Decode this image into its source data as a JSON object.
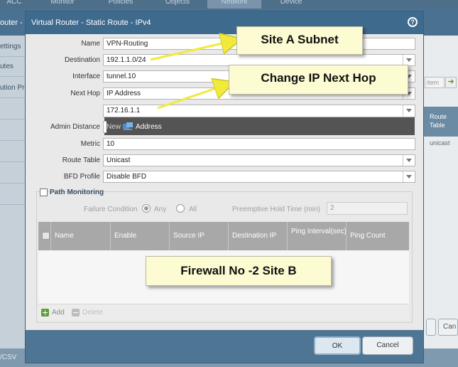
{
  "background": {
    "tabs": [
      "ACC",
      "Monitor",
      "Policies",
      "Objects",
      "Network",
      "Device"
    ],
    "active_tab": "Network",
    "window_title": "outer - d",
    "left_items": [
      "ettings",
      "utes",
      "ution Pr"
    ],
    "right_button": "item",
    "right_col_header": "Route Table",
    "right_col_value": "unicast",
    "bottom_text": "/CSV",
    "right_bottom_button": "Can"
  },
  "dialog": {
    "title": "Virtual Router - Static Route - IPv4",
    "fields": {
      "name": {
        "label": "Name",
        "value": "VPN-Routing"
      },
      "destination": {
        "label": "Destination",
        "value": "192.1.1.0/24"
      },
      "interface": {
        "label": "Interface",
        "value": "tunnel.10"
      },
      "next_hop": {
        "label": "Next Hop",
        "value": "IP Address"
      },
      "next_hop_ip": {
        "value": "172.16.1.1"
      },
      "admin_distance": {
        "label": "Admin Distance",
        "value": ""
      },
      "metric": {
        "label": "Metric",
        "value": "10"
      },
      "route_table": {
        "label": "Route Table",
        "value": "Unicast"
      },
      "bfd_profile": {
        "label": "BFD Profile",
        "value": "Disable BFD"
      }
    },
    "address_popup": {
      "new_label": "New",
      "address_label": "Address"
    },
    "path_monitoring": {
      "label": "Path Monitoring",
      "failure_condition_label": "Failure Condition",
      "options": [
        "Any",
        "All"
      ],
      "selected": "Any",
      "hold_time_label": "Preemptive Hold Time (min)",
      "hold_time_value": "2",
      "columns": [
        "Name",
        "Enable",
        "Source IP",
        "Destination IP",
        "Ping Interval(sec)",
        "Ping Count"
      ],
      "add_label": "Add",
      "delete_label": "Delete"
    },
    "buttons": {
      "ok": "OK",
      "cancel": "Cancel"
    }
  },
  "annotations": {
    "site_a": "Site A Subnet",
    "next_hop": "Change IP  Next Hop",
    "site_b": "Firewall No -2 Site B"
  }
}
